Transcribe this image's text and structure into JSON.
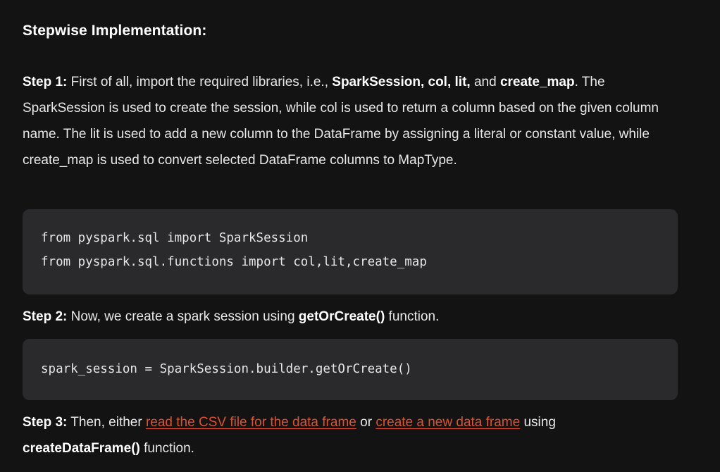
{
  "heading": "Stepwise Implementation:",
  "step1": {
    "label": "Step 1:",
    "text_a": " First of all, import the required libraries, i.e., ",
    "bold_libs": "SparkSession, col, lit,",
    "text_and": " and ",
    "bold_create_map": "create_map",
    "text_b": ". The SparkSession is used to create the session, while col is used to return a column based on the given column name. The lit is used to add a new column to the DataFrame by assigning a literal or constant value, while create_map is used to convert selected DataFrame columns to MapType."
  },
  "code1": {
    "lines": [
      "from pyspark.sql import SparkSession",
      "from pyspark.sql.functions import col,lit,create_map"
    ]
  },
  "step2": {
    "label": "Step 2:",
    "text_a": " Now, we create a spark session using ",
    "bold_fn": "getOrCreate()",
    "text_b": " function."
  },
  "code2": {
    "lines": [
      "spark_session = SparkSession.builder.getOrCreate()"
    ]
  },
  "step3": {
    "label": "Step 3:",
    "text_a": " Then, either ",
    "link1": "read the CSV file for the data frame",
    "text_or": " or ",
    "link2": "create a new data frame",
    "text_using": " using ",
    "bold_fn": "createDataFrame()",
    "text_b": " function."
  },
  "colors": {
    "background": "#131313",
    "code_background": "#2a2a2c",
    "link": "#e0502d",
    "text": "#e8e8e8"
  }
}
